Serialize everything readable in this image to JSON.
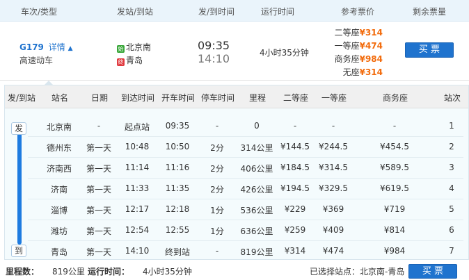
{
  "header": {
    "col_train": "车次/类型",
    "col_stations": "发站/到站",
    "col_times": "发/到时间",
    "col_duration": "运行时间",
    "col_price": "参考票价",
    "col_remaining": "剩余票量"
  },
  "train": {
    "number": "G179",
    "detail_link": "详情",
    "type": "高速动车",
    "from_tag": "始",
    "from": "北京南",
    "to_tag": "终",
    "to": "青岛",
    "depart": "09:35",
    "arrive": "14:10",
    "duration": "4小时35分钟",
    "prices": [
      {
        "seat": "二等座",
        "price": "¥314"
      },
      {
        "seat": "一等座",
        "price": "¥474"
      },
      {
        "seat": "商务座",
        "price": "¥984"
      },
      {
        "seat": "无座",
        "price": "¥314"
      }
    ],
    "buy_label": "买 票"
  },
  "detail": {
    "columns": [
      "发/到站",
      "站名",
      "日期",
      "到达时间",
      "开车时间",
      "停车时间",
      "里程",
      "二等座",
      "一等座",
      "商务座",
      "站次"
    ],
    "start_badge": "发",
    "end_badge": "到",
    "rows": [
      [
        "北京南",
        "-",
        "起点站",
        "09:35",
        "-",
        "0",
        "-",
        "-",
        "-",
        "1"
      ],
      [
        "德州东",
        "第一天",
        "10:48",
        "10:50",
        "2分",
        "314公里",
        "¥144.5",
        "¥244.5",
        "¥454.5",
        "2"
      ],
      [
        "济南西",
        "第一天",
        "11:14",
        "11:16",
        "2分",
        "406公里",
        "¥184.5",
        "¥314.5",
        "¥589.5",
        "3"
      ],
      [
        "济南",
        "第一天",
        "11:33",
        "11:35",
        "2分",
        "426公里",
        "¥194.5",
        "¥329.5",
        "¥619.5",
        "4"
      ],
      [
        "淄博",
        "第一天",
        "12:17",
        "12:18",
        "1分",
        "536公里",
        "¥229",
        "¥369",
        "¥719",
        "5"
      ],
      [
        "潍坊",
        "第一天",
        "12:54",
        "12:55",
        "1分",
        "636公里",
        "¥259",
        "¥409",
        "¥814",
        "6"
      ],
      [
        "青岛",
        "第一天",
        "14:10",
        "终到站",
        "-",
        "819公里",
        "¥314",
        "¥474",
        "¥984",
        "7"
      ]
    ]
  },
  "footer": {
    "distance_label": "里程数：",
    "distance_value": "819公里",
    "duration_label": "运行时间：",
    "duration_value": "4小时35分钟",
    "selected_label": "已选择站点：北京南-青岛",
    "buy_label": "买 票"
  },
  "colors": {
    "accent": "#1f73ce",
    "price": "#f26b0c",
    "from_tag": "#3aa73a",
    "to_tag": "#e0393e"
  }
}
